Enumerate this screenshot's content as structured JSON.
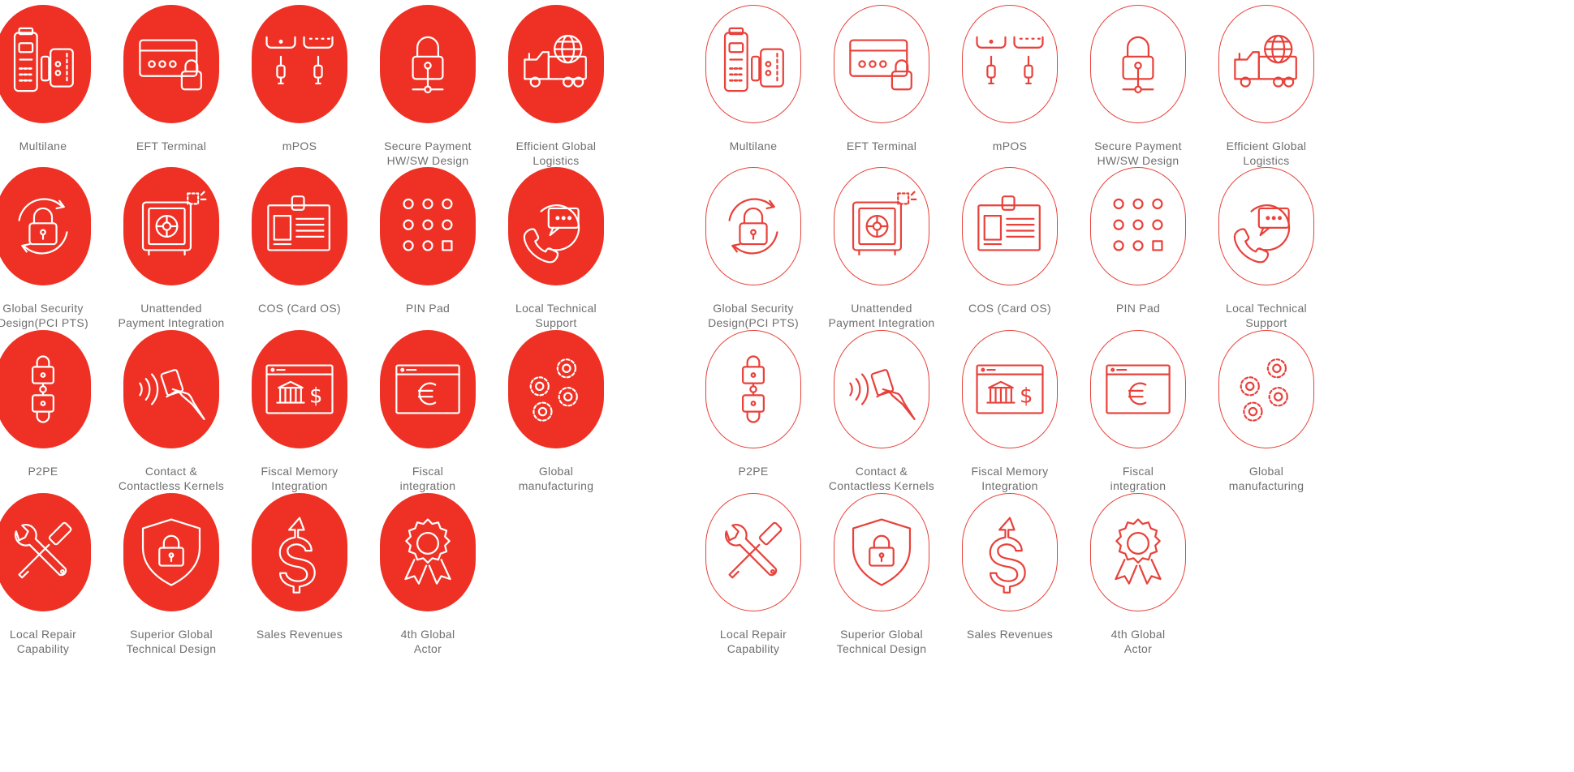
{
  "accent_color": "#ee3124",
  "panels": [
    {
      "style": "filled",
      "tiles": [
        {
          "label": "Multilane",
          "icon": "multilane-terminal-icon"
        },
        {
          "label": "EFT Terminal",
          "icon": "eft-terminal-icon"
        },
        {
          "label": "mPOS",
          "icon": "mpos-icon"
        },
        {
          "label": "Secure Payment\nHW/SW Design",
          "icon": "secure-payment-lock-icon"
        },
        {
          "label": "Efficient Global\nLogistics",
          "icon": "logistics-truck-icon"
        },
        {
          "label": "Global Security\nDesign(PCI PTS)",
          "icon": "security-cycle-lock-icon"
        },
        {
          "label": "Unattended\nPayment Integration",
          "icon": "safe-vault-icon"
        },
        {
          "label": "COS (Card OS)",
          "icon": "id-card-icon"
        },
        {
          "label": "PIN Pad",
          "icon": "pin-pad-icon"
        },
        {
          "label": "Local Technical\nSupport",
          "icon": "phone-support-icon"
        },
        {
          "label": "P2PE",
          "icon": "p2pe-locks-icon"
        },
        {
          "label": "Contact &\nContactless Kernels",
          "icon": "contactless-card-icon"
        },
        {
          "label": "Fiscal Memory\nIntegration",
          "icon": "fiscal-bank-window-icon"
        },
        {
          "label": "Fiscal\nintegration",
          "icon": "euro-window-icon"
        },
        {
          "label": "Global\nmanufacturing",
          "icon": "gears-icon"
        },
        {
          "label": "Local Repair\nCapability",
          "icon": "wrench-screwdriver-icon"
        },
        {
          "label": "Superior Global\nTechnical Design",
          "icon": "shield-lock-icon"
        },
        {
          "label": "Sales Revenues",
          "icon": "dollar-arrow-icon"
        },
        {
          "label": "4th Global\nActor",
          "icon": "award-ribbon-icon"
        }
      ]
    },
    {
      "style": "outline",
      "tiles": [
        {
          "label": "Multilane",
          "icon": "multilane-terminal-icon"
        },
        {
          "label": "EFT Terminal",
          "icon": "eft-terminal-icon"
        },
        {
          "label": "mPOS",
          "icon": "mpos-icon"
        },
        {
          "label": "Secure Payment\nHW/SW Design",
          "icon": "secure-payment-lock-icon"
        },
        {
          "label": "Efficient Global\nLogistics",
          "icon": "logistics-truck-icon"
        },
        {
          "label": "Global Security\nDesign(PCI PTS)",
          "icon": "security-cycle-lock-icon"
        },
        {
          "label": "Unattended\nPayment Integration",
          "icon": "safe-vault-icon"
        },
        {
          "label": "COS (Card OS)",
          "icon": "id-card-icon"
        },
        {
          "label": "PIN Pad",
          "icon": "pin-pad-icon"
        },
        {
          "label": "Local Technical\nSupport",
          "icon": "phone-support-icon"
        },
        {
          "label": "P2PE",
          "icon": "p2pe-locks-icon"
        },
        {
          "label": "Contact &\nContactless Kernels",
          "icon": "contactless-card-icon"
        },
        {
          "label": "Fiscal Memory\nIntegration",
          "icon": "fiscal-bank-window-icon"
        },
        {
          "label": "Fiscal\nintegration",
          "icon": "euro-window-icon"
        },
        {
          "label": "Global\nmanufacturing",
          "icon": "gears-icon"
        },
        {
          "label": "Local Repair\nCapability",
          "icon": "wrench-screwdriver-icon"
        },
        {
          "label": "Superior Global\nTechnical Design",
          "icon": "shield-lock-icon"
        },
        {
          "label": "Sales Revenues",
          "icon": "dollar-arrow-icon"
        },
        {
          "label": "4th Global\nActor",
          "icon": "award-ribbon-icon"
        }
      ]
    }
  ]
}
